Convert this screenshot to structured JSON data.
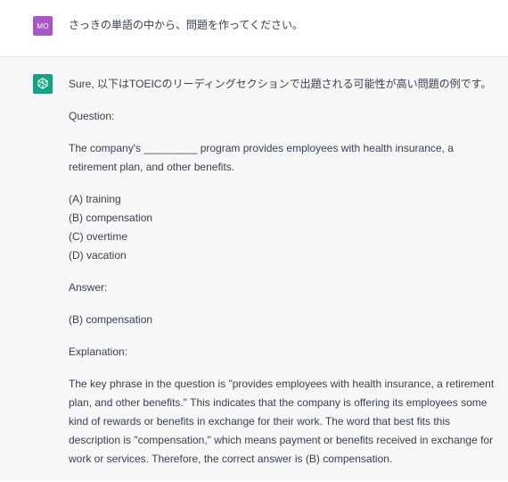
{
  "user": {
    "avatar_initials": "MO",
    "avatar_color": "#a855c7",
    "message": "さっきの単語の中から、問題を作ってください。"
  },
  "assistant": {
    "avatar_color": "#10a37f",
    "intro": "Sure, 以下はTOEICのリーディングセクションで出題される可能性が高い問題の例です。",
    "question_label": "Question:",
    "question_text": "The company's _________ program provides employees with health insurance, a retirement plan, and other benefits.",
    "options": [
      "(A) training",
      "(B) compensation",
      "(C) overtime",
      "(D) vacation"
    ],
    "answer_label": "Answer:",
    "answer_text": "(B) compensation",
    "explanation_label": "Explanation:",
    "explanation_text": "The key phrase in the question is \"provides employees with health insurance, a retirement plan, and other benefits.\" This indicates that the company is offering its employees some kind of rewards or benefits in exchange for their work. The word that best fits this description is \"compensation,\" which means payment or benefits received in exchange for work or services. Therefore, the correct answer is (B) compensation."
  }
}
